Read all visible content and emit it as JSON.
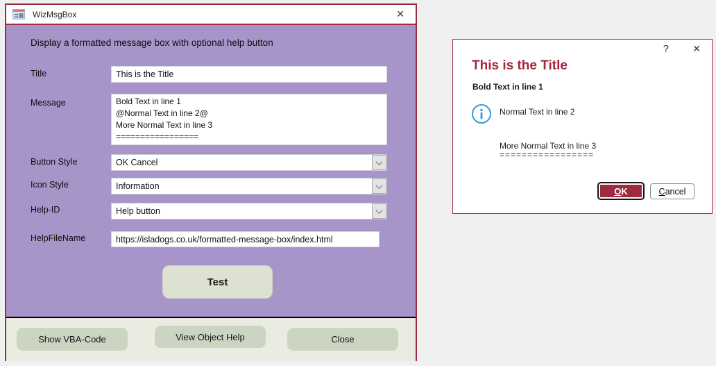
{
  "window": {
    "title": "WizMsgBox",
    "close_glyph": "✕",
    "heading": "Display a formatted message box with optional help button",
    "fields": {
      "title": {
        "label": "Title",
        "value": "This is the Title"
      },
      "message": {
        "label": "Message",
        "value": "Bold Text in line 1\n@Normal Text in line 2@\nMore Normal Text in line 3\n================="
      },
      "button_style": {
        "label": "Button Style",
        "value": "OK Cancel"
      },
      "icon_style": {
        "label": "Icon Style",
        "value": "Information"
      },
      "help_id": {
        "label": "Help-ID",
        "value": "Help button"
      },
      "help_file_name": {
        "label": "HelpFileName",
        "value": "https://isladogs.co.uk/formatted-message-box/index.html"
      }
    },
    "test_button_label": "Test",
    "footer_buttons": [
      "Show VBA-Code",
      "View Object Help",
      "Close"
    ]
  },
  "dialog": {
    "help_glyph": "?",
    "close_glyph": "✕",
    "title": "This is the Title",
    "bold_line": "Bold Text in line 1",
    "normal_line": "Normal Text in line 2",
    "more_line": "More Normal Text in line 3",
    "equals_line": "=================",
    "ok_button": {
      "underlined": "O",
      "rest": "K"
    },
    "cancel_button": {
      "underlined": "C",
      "rest": "ancel"
    }
  },
  "colors": {
    "accent_red": "#9e2b3f",
    "dialog_title_red": "#a4253a",
    "form_purple": "#a795c9",
    "footer_bg": "#eaece1",
    "button_sage": "#ccd5c2",
    "info_blue": "#2e9bd6"
  }
}
